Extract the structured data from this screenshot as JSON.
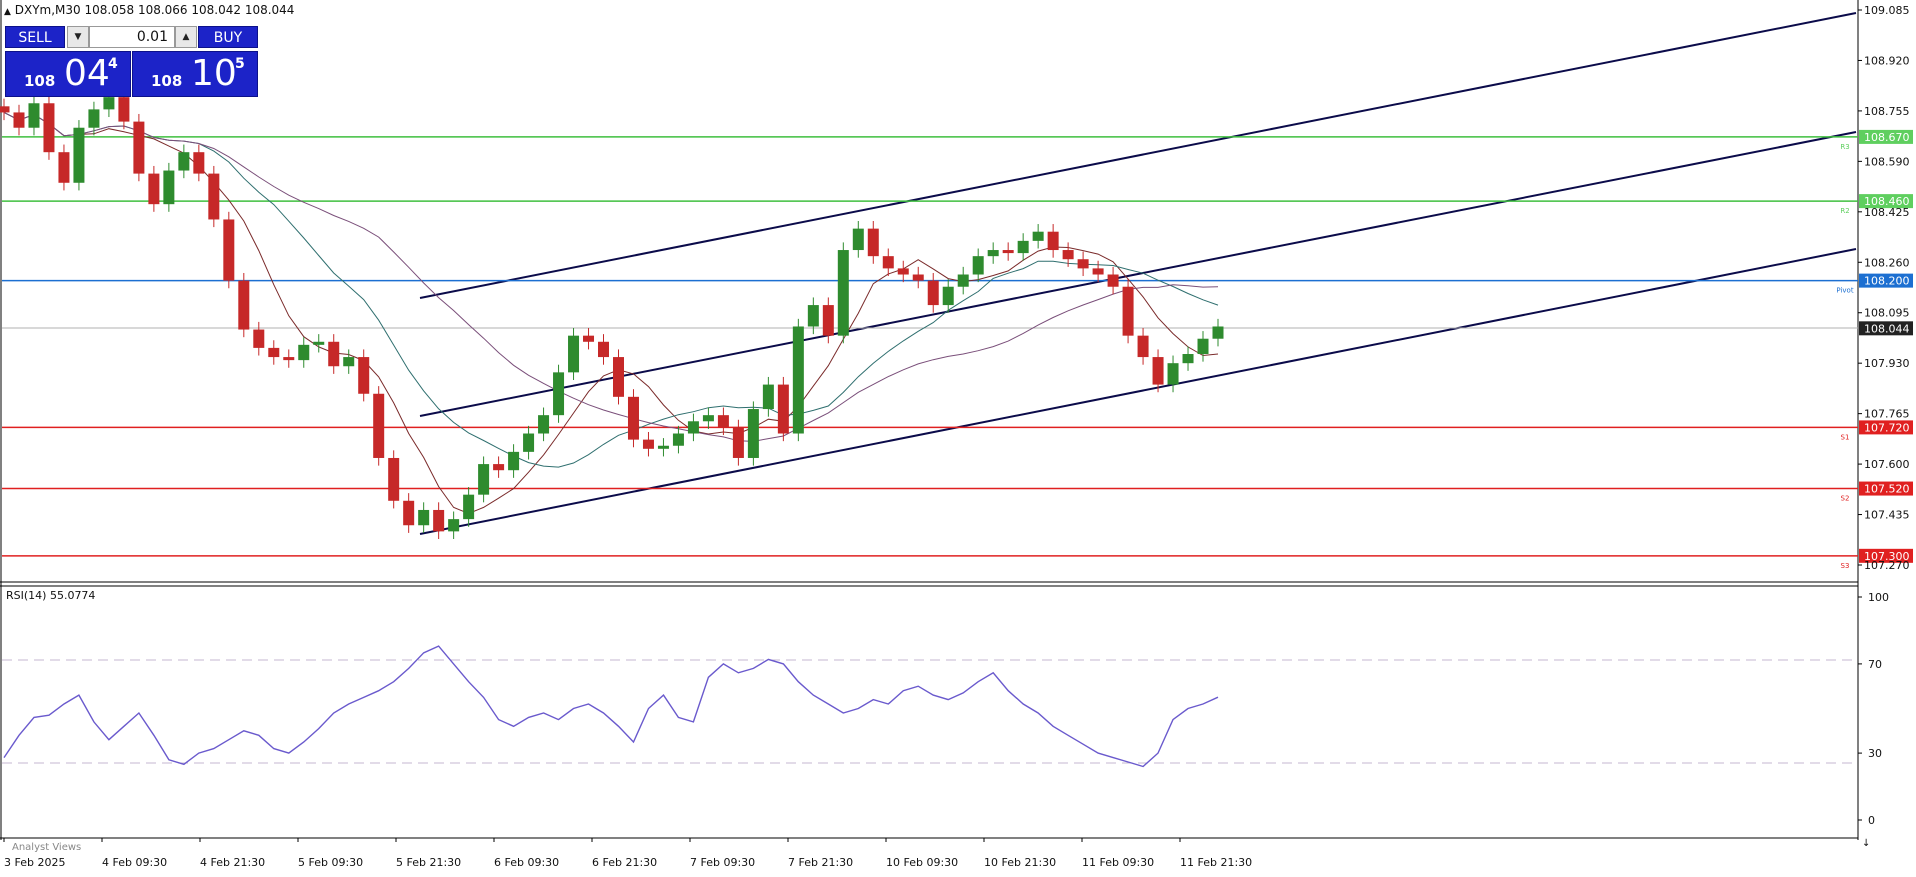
{
  "header": {
    "title": "DXYm,M30",
    "ohlc": "108.058 108.066 108.042 108.044"
  },
  "trade_panel": {
    "sell_label": "SELL",
    "buy_label": "BUY",
    "lot_value": "0.01",
    "sell_price": {
      "prefix": "108",
      "big": "04",
      "sup": "4"
    },
    "buy_price": {
      "prefix": "108",
      "big": "10",
      "sup": "5"
    }
  },
  "price_axis": {
    "ticks": [
      "109.085",
      "108.920",
      "108.755",
      "108.590",
      "108.425",
      "108.260",
      "108.095",
      "107.930",
      "107.765",
      "107.600",
      "107.435",
      "107.270"
    ],
    "current_price": "108.044"
  },
  "levels": [
    {
      "value": 108.67,
      "label": "108.670",
      "name": "R3",
      "color": "#3fbf3f",
      "lcolor": "#5fcf5f"
    },
    {
      "value": 108.46,
      "label": "108.460",
      "name": "R2",
      "color": "#3fbf3f",
      "lcolor": "#5fcf5f"
    },
    {
      "value": 108.2,
      "label": "108.200",
      "name": "Pivot",
      "color": "#1c6fd1",
      "lcolor": "#1c6fd1"
    },
    {
      "value": 107.72,
      "label": "107.720",
      "name": "S1",
      "color": "#e02020",
      "lcolor": "#e02020"
    },
    {
      "value": 107.52,
      "label": "107.520",
      "name": "S2",
      "color": "#e02020",
      "lcolor": "#e02020"
    },
    {
      "value": 107.3,
      "label": "107.300",
      "name": "S3",
      "color": "#e02020",
      "lcolor": "#e02020"
    }
  ],
  "rsi": {
    "label": "RSI(14) 55.0774",
    "ticks": [
      "100",
      "70",
      "30",
      "0"
    ]
  },
  "time_axis": {
    "labels": [
      "3 Feb 2025",
      "4 Feb 09:30",
      "4 Feb 21:30",
      "5 Feb 09:30",
      "5 Feb 21:30",
      "6 Feb 09:30",
      "6 Feb 21:30",
      "7 Feb 09:30",
      "7 Feb 21:30",
      "10 Feb 09:30",
      "10 Feb 21:30",
      "11 Feb 09:30",
      "11 Feb 21:30"
    ]
  },
  "bottom_bar": {
    "label": "Analyst Views"
  },
  "chart_data": {
    "type": "candlestick",
    "symbol": "DXYm",
    "timeframe": "M30",
    "ylim": [
      107.27,
      109.085
    ],
    "price_series": [
      {
        "t": 0,
        "c": 108.75
      },
      {
        "t": 1,
        "c": 108.7
      },
      {
        "t": 2,
        "c": 108.78
      },
      {
        "t": 3,
        "c": 108.62
      },
      {
        "t": 4,
        "c": 108.52
      },
      {
        "t": 5,
        "c": 108.7
      },
      {
        "t": 6,
        "c": 108.76
      },
      {
        "t": 7,
        "c": 108.8
      },
      {
        "t": 8,
        "c": 108.72
      },
      {
        "t": 9,
        "c": 108.55
      },
      {
        "t": 10,
        "c": 108.45
      },
      {
        "t": 11,
        "c": 108.56
      },
      {
        "t": 12,
        "c": 108.62
      },
      {
        "t": 13,
        "c": 108.55
      },
      {
        "t": 14,
        "c": 108.4
      },
      {
        "t": 15,
        "c": 108.2
      },
      {
        "t": 16,
        "c": 108.04
      },
      {
        "t": 17,
        "c": 107.98
      },
      {
        "t": 18,
        "c": 107.95
      },
      {
        "t": 19,
        "c": 107.94
      },
      {
        "t": 20,
        "c": 107.99
      },
      {
        "t": 21,
        "c": 108.0
      },
      {
        "t": 22,
        "c": 107.92
      },
      {
        "t": 23,
        "c": 107.95
      },
      {
        "t": 24,
        "c": 107.83
      },
      {
        "t": 25,
        "c": 107.62
      },
      {
        "t": 26,
        "c": 107.48
      },
      {
        "t": 27,
        "c": 107.4
      },
      {
        "t": 28,
        "c": 107.45
      },
      {
        "t": 29,
        "c": 107.38
      },
      {
        "t": 30,
        "c": 107.42
      },
      {
        "t": 31,
        "c": 107.5
      },
      {
        "t": 32,
        "c": 107.6
      },
      {
        "t": 33,
        "c": 107.58
      },
      {
        "t": 34,
        "c": 107.64
      },
      {
        "t": 35,
        "c": 107.7
      },
      {
        "t": 36,
        "c": 107.76
      },
      {
        "t": 37,
        "c": 107.9
      },
      {
        "t": 38,
        "c": 108.02
      },
      {
        "t": 39,
        "c": 108.0
      },
      {
        "t": 40,
        "c": 107.95
      },
      {
        "t": 41,
        "c": 107.82
      },
      {
        "t": 42,
        "c": 107.68
      },
      {
        "t": 43,
        "c": 107.65
      },
      {
        "t": 44,
        "c": 107.66
      },
      {
        "t": 45,
        "c": 107.7
      },
      {
        "t": 46,
        "c": 107.74
      },
      {
        "t": 47,
        "c": 107.76
      },
      {
        "t": 48,
        "c": 107.72
      },
      {
        "t": 49,
        "c": 107.62
      },
      {
        "t": 50,
        "c": 107.78
      },
      {
        "t": 51,
        "c": 107.86
      },
      {
        "t": 52,
        "c": 107.7
      },
      {
        "t": 53,
        "c": 108.05
      },
      {
        "t": 54,
        "c": 108.12
      },
      {
        "t": 55,
        "c": 108.02
      },
      {
        "t": 56,
        "c": 108.3
      },
      {
        "t": 57,
        "c": 108.37
      },
      {
        "t": 58,
        "c": 108.28
      },
      {
        "t": 59,
        "c": 108.24
      },
      {
        "t": 60,
        "c": 108.22
      },
      {
        "t": 61,
        "c": 108.2
      },
      {
        "t": 62,
        "c": 108.12
      },
      {
        "t": 63,
        "c": 108.18
      },
      {
        "t": 64,
        "c": 108.22
      },
      {
        "t": 65,
        "c": 108.28
      },
      {
        "t": 66,
        "c": 108.3
      },
      {
        "t": 67,
        "c": 108.29
      },
      {
        "t": 68,
        "c": 108.33
      },
      {
        "t": 69,
        "c": 108.36
      },
      {
        "t": 70,
        "c": 108.3
      },
      {
        "t": 71,
        "c": 108.27
      },
      {
        "t": 72,
        "c": 108.24
      },
      {
        "t": 73,
        "c": 108.22
      },
      {
        "t": 74,
        "c": 108.18
      },
      {
        "t": 75,
        "c": 108.02
      },
      {
        "t": 76,
        "c": 107.95
      },
      {
        "t": 77,
        "c": 107.86
      },
      {
        "t": 78,
        "c": 107.93
      },
      {
        "t": 79,
        "c": 107.96
      },
      {
        "t": 80,
        "c": 108.01
      },
      {
        "t": 81,
        "c": 108.05
      }
    ],
    "rsi_series": [
      {
        "t": 0,
        "v": 28
      },
      {
        "t": 1,
        "v": 38
      },
      {
        "t": 2,
        "v": 46
      },
      {
        "t": 3,
        "v": 47
      },
      {
        "t": 4,
        "v": 52
      },
      {
        "t": 5,
        "v": 56
      },
      {
        "t": 6,
        "v": 44
      },
      {
        "t": 7,
        "v": 36
      },
      {
        "t": 8,
        "v": 42
      },
      {
        "t": 9,
        "v": 48
      },
      {
        "t": 10,
        "v": 38
      },
      {
        "t": 11,
        "v": 27
      },
      {
        "t": 12,
        "v": 25
      },
      {
        "t": 13,
        "v": 30
      },
      {
        "t": 14,
        "v": 32
      },
      {
        "t": 15,
        "v": 36
      },
      {
        "t": 16,
        "v": 40
      },
      {
        "t": 17,
        "v": 38
      },
      {
        "t": 18,
        "v": 32
      },
      {
        "t": 19,
        "v": 30
      },
      {
        "t": 20,
        "v": 35
      },
      {
        "t": 21,
        "v": 41
      },
      {
        "t": 22,
        "v": 48
      },
      {
        "t": 23,
        "v": 52
      },
      {
        "t": 24,
        "v": 55
      },
      {
        "t": 25,
        "v": 58
      },
      {
        "t": 26,
        "v": 62
      },
      {
        "t": 27,
        "v": 68
      },
      {
        "t": 28,
        "v": 75
      },
      {
        "t": 29,
        "v": 78
      },
      {
        "t": 30,
        "v": 70
      },
      {
        "t": 31,
        "v": 62
      },
      {
        "t": 32,
        "v": 55
      },
      {
        "t": 33,
        "v": 45
      },
      {
        "t": 34,
        "v": 42
      },
      {
        "t": 35,
        "v": 46
      },
      {
        "t": 36,
        "v": 48
      },
      {
        "t": 37,
        "v": 45
      },
      {
        "t": 38,
        "v": 50
      },
      {
        "t": 39,
        "v": 52
      },
      {
        "t": 40,
        "v": 48
      },
      {
        "t": 41,
        "v": 42
      },
      {
        "t": 42,
        "v": 35
      },
      {
        "t": 43,
        "v": 50
      },
      {
        "t": 44,
        "v": 56
      },
      {
        "t": 45,
        "v": 46
      },
      {
        "t": 46,
        "v": 44
      },
      {
        "t": 47,
        "v": 64
      },
      {
        "t": 48,
        "v": 70
      },
      {
        "t": 49,
        "v": 66
      },
      {
        "t": 50,
        "v": 68
      },
      {
        "t": 51,
        "v": 72
      },
      {
        "t": 52,
        "v": 70
      },
      {
        "t": 53,
        "v": 62
      },
      {
        "t": 54,
        "v": 56
      },
      {
        "t": 55,
        "v": 52
      },
      {
        "t": 56,
        "v": 48
      },
      {
        "t": 57,
        "v": 50
      },
      {
        "t": 58,
        "v": 54
      },
      {
        "t": 59,
        "v": 52
      },
      {
        "t": 60,
        "v": 58
      },
      {
        "t": 61,
        "v": 60
      },
      {
        "t": 62,
        "v": 56
      },
      {
        "t": 63,
        "v": 54
      },
      {
        "t": 64,
        "v": 57
      },
      {
        "t": 65,
        "v": 62
      },
      {
        "t": 66,
        "v": 66
      },
      {
        "t": 67,
        "v": 58
      },
      {
        "t": 68,
        "v": 52
      },
      {
        "t": 69,
        "v": 48
      },
      {
        "t": 70,
        "v": 42
      },
      {
        "t": 71,
        "v": 38
      },
      {
        "t": 72,
        "v": 34
      },
      {
        "t": 73,
        "v": 30
      },
      {
        "t": 74,
        "v": 28
      },
      {
        "t": 75,
        "v": 26
      },
      {
        "t": 76,
        "v": 24
      },
      {
        "t": 77,
        "v": 30
      },
      {
        "t": 78,
        "v": 45
      },
      {
        "t": 79,
        "v": 50
      },
      {
        "t": 80,
        "v": 52
      },
      {
        "t": 81,
        "v": 55.08
      }
    ]
  }
}
